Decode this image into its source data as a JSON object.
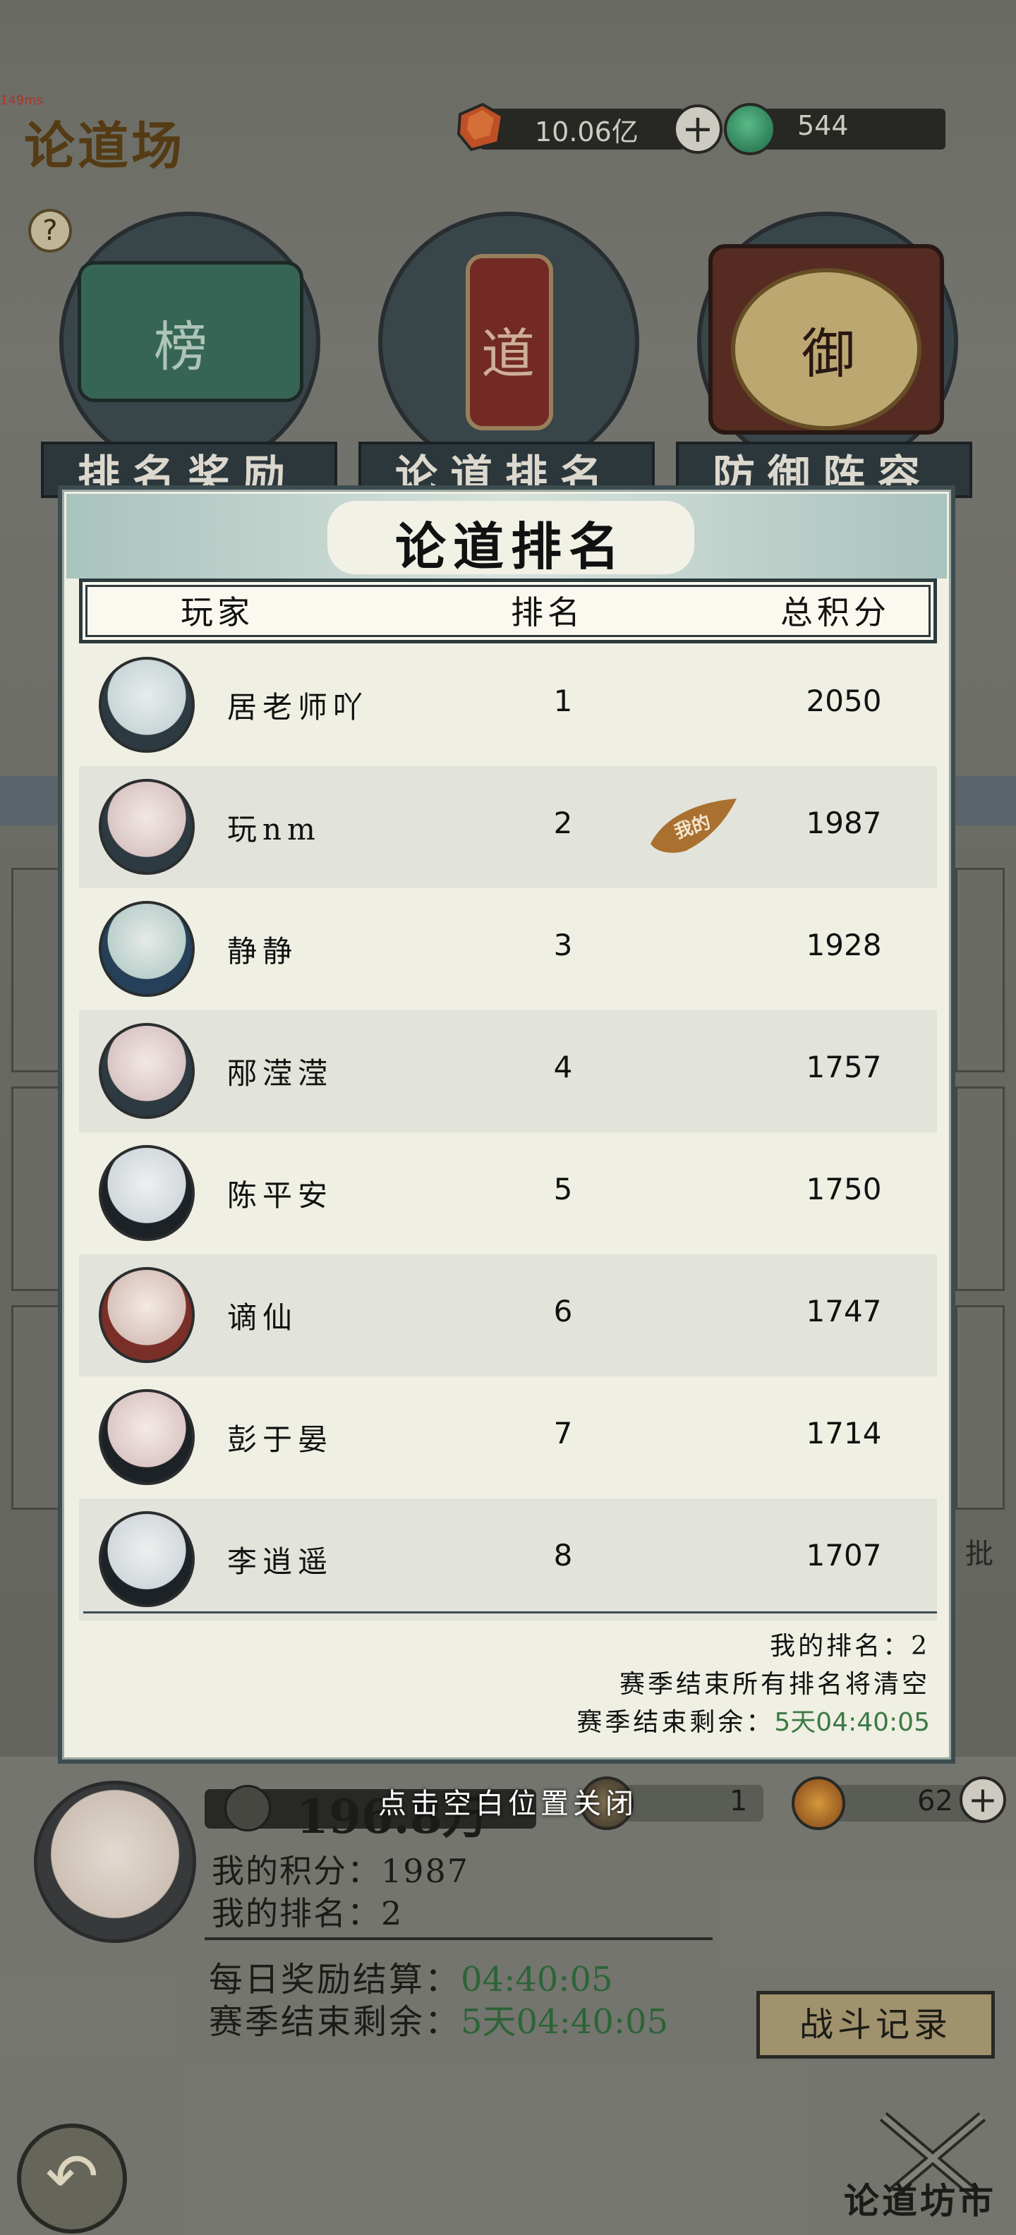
{
  "debug_ms": "149ms",
  "header": {
    "title": "论道场",
    "currency_ore": "10.06亿",
    "currency_jade": "544",
    "help_label": "?",
    "plus_label": "+"
  },
  "menu": [
    {
      "label": "排名奖励",
      "emblem_text": "榜"
    },
    {
      "label": "论道排名",
      "emblem_text": "道"
    },
    {
      "label": "防御阵容",
      "emblem_text": "御"
    }
  ],
  "background_hint_text": "批",
  "modal": {
    "title": "论道排名",
    "columns": {
      "player": "玩家",
      "rank": "排名",
      "score": "总积分"
    },
    "my_stamp": "我的",
    "rows": [
      {
        "name": "居老师吖",
        "rank": "1",
        "score": "2050"
      },
      {
        "name": "玩nm",
        "rank": "2",
        "score": "1987"
      },
      {
        "name": "静静",
        "rank": "3",
        "score": "1928"
      },
      {
        "name": "邴滢滢",
        "rank": "4",
        "score": "1757"
      },
      {
        "name": "陈平安",
        "rank": "5",
        "score": "1750"
      },
      {
        "name": "谪仙",
        "rank": "6",
        "score": "1747"
      },
      {
        "name": "彭于晏",
        "rank": "7",
        "score": "1714"
      },
      {
        "name": "李逍遥",
        "rank": "8",
        "score": "1707"
      }
    ],
    "my_rank_label": "我的排名：",
    "my_rank_value": "2",
    "season_notice": "赛季结束所有排名将清空",
    "season_remaining_label": "赛季结束剩余：",
    "season_remaining_value": "5天04:40:05"
  },
  "close_hint": "点击空白位置关闭",
  "bottom": {
    "power_value": "196.8万",
    "ticket_value": "1",
    "token_value": "62",
    "my_score_label": "我的积分：",
    "my_score_value": "1987",
    "my_rank_label": "我的排名：",
    "my_rank_value": "2",
    "daily_reward_label": "每日奖励结算：",
    "daily_reward_value": "04:40:05",
    "season_end_label": "赛季结束剩余：",
    "season_end_value": "5天04:40:05",
    "battle_log_button": "战斗记录",
    "shop_label": "论道坊市"
  },
  "colors": {
    "accent_green": "#3c7a44",
    "modal_bg": "#efefe4",
    "modal_border": "#3d4c4f"
  }
}
